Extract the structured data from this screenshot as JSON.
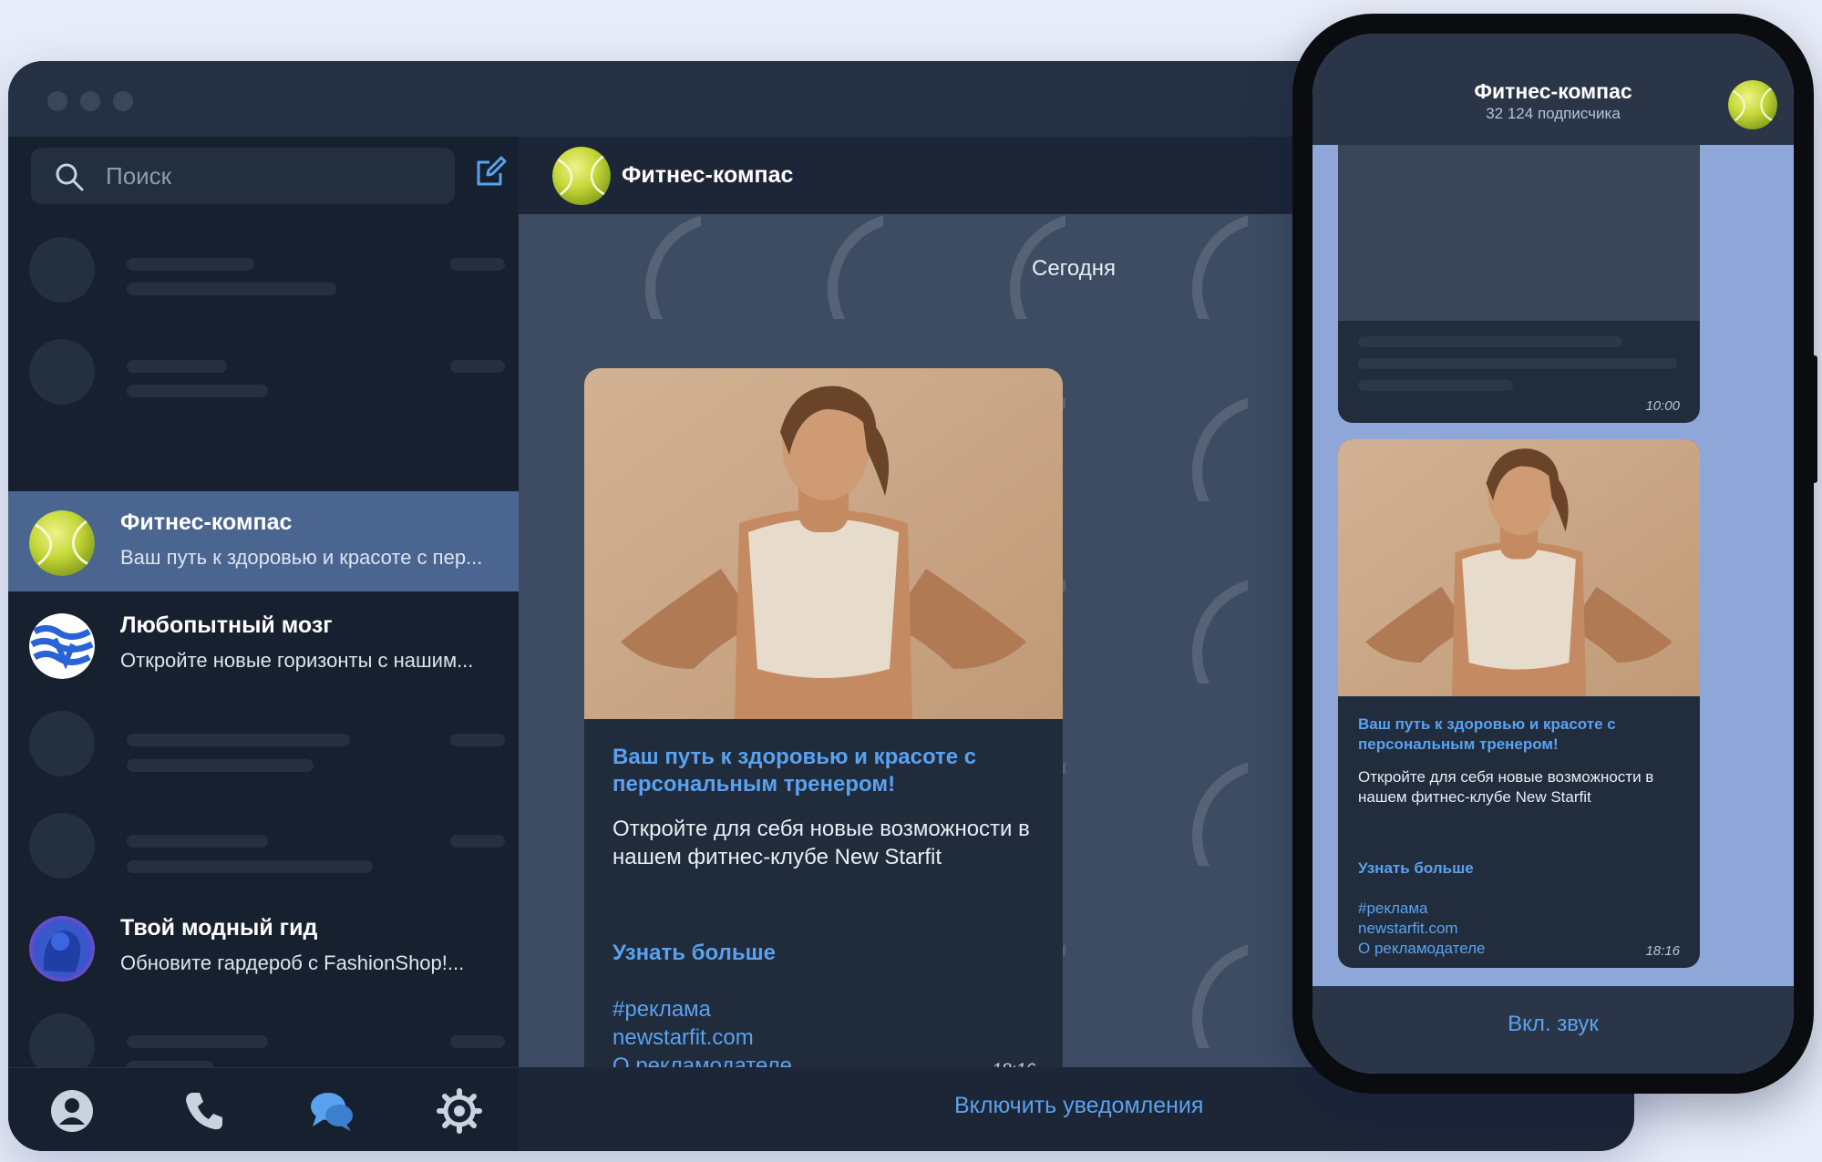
{
  "sidebar": {
    "search_placeholder": "Поиск",
    "chats": [
      {
        "name": "Фитнес-компас",
        "preview": "Ваш путь к здоровью и красоте с пер..."
      },
      {
        "name": "Любопытный мозг",
        "preview": "Откройте новые горизонты с нашим..."
      },
      {
        "name": "Твой модный гид",
        "preview": "Обновите гардероб с FashionShop!..."
      }
    ]
  },
  "chat": {
    "title": "Фитнес-компас",
    "date_label": "Сегодня",
    "post": {
      "headline": "Ваш путь к здоровью и красоте с персональным тренером!",
      "body": "Откройте для себя новые возможности в нашем фитнес-клубе New Starfit",
      "cta": "Узнать больше",
      "hashtag": "#реклама",
      "site": "newstarfit.com",
      "advertiser": "О рекламодателе",
      "time": "18:16"
    },
    "notify_label": "Включить уведомления"
  },
  "phone": {
    "title": "Фитнес-компас",
    "subtitle": "32 124 подписчика",
    "prev_time": "10:00",
    "sound_label": "Вкл. звук"
  },
  "colors": {
    "accent": "#5aa2f0",
    "active_chat": "#4a6590",
    "sidebar_bg": "#17202e",
    "chat_bg": "#3d4c63",
    "page_bg": "#e9edf9"
  }
}
